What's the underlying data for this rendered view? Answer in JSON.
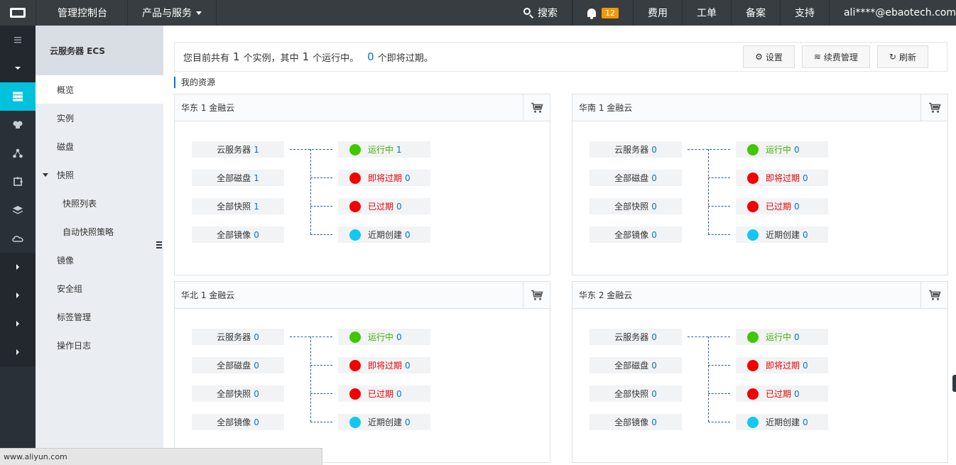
{
  "topbar": {
    "console": "管理控制台",
    "products": "产品与服务",
    "search": "搜索",
    "notify_count": "12",
    "billing": "费用",
    "ticket": "工单",
    "icp": "备案",
    "support": "支持",
    "user": "ali****@ebaotech.com"
  },
  "subnav": {
    "title": "云服务器 ECS",
    "items": [
      {
        "label": "概览"
      },
      {
        "label": "实例"
      },
      {
        "label": "磁盘"
      },
      {
        "label": "快照"
      },
      {
        "label": "快照列表"
      },
      {
        "label": "自动快照策略"
      },
      {
        "label": "镜像"
      },
      {
        "label": "安全组"
      },
      {
        "label": "标签管理"
      },
      {
        "label": "操作日志"
      }
    ]
  },
  "summary": {
    "prefix": "您目前共有",
    "total": "1",
    "mid": "个实例，其中",
    "running": "1",
    "mid2": "个运行中。",
    "expiring": "0",
    "suffix": "个即将过期。"
  },
  "buttons": {
    "settings": "设置",
    "renew": "续费管理",
    "refresh": "刷新"
  },
  "section_title": "我的资源",
  "panels": [
    {
      "region": "华东 1 金融云",
      "servers_label": "云服务器",
      "servers": "1",
      "disks_label": "全部磁盘",
      "disks": "1",
      "snapshots_label": "全部快照",
      "snapshots": "1",
      "images_label": "全部镜像",
      "images": "0",
      "running_label": "运行中",
      "running": "1",
      "expiring_label": "即将过期",
      "expiring": "0",
      "expired_label": "已过期",
      "expired": "0",
      "recent_label": "近期创建",
      "recent": "0"
    },
    {
      "region": "华南 1 金融云",
      "servers_label": "云服务器",
      "servers": "0",
      "disks_label": "全部磁盘",
      "disks": "0",
      "snapshots_label": "全部快照",
      "snapshots": "0",
      "images_label": "全部镜像",
      "images": "0",
      "running_label": "运行中",
      "running": "0",
      "expiring_label": "即将过期",
      "expiring": "0",
      "expired_label": "已过期",
      "expired": "0",
      "recent_label": "近期创建",
      "recent": "0"
    },
    {
      "region": "华北 1 金融云",
      "servers_label": "云服务器",
      "servers": "0",
      "disks_label": "全部磁盘",
      "disks": "0",
      "snapshots_label": "全部快照",
      "snapshots": "0",
      "images_label": "全部镜像",
      "images": "0",
      "running_label": "运行中",
      "running": "0",
      "expiring_label": "即将过期",
      "expiring": "0",
      "expired_label": "已过期",
      "expired": "0",
      "recent_label": "近期创建",
      "recent": "0"
    },
    {
      "region": "华东 2 金融云",
      "servers_label": "云服务器",
      "servers": "0",
      "disks_label": "全部磁盘",
      "disks": "0",
      "snapshots_label": "全部快照",
      "snapshots": "0",
      "images_label": "全部镜像",
      "images": "0",
      "running_label": "运行中",
      "running": "0",
      "expiring_label": "即将过期",
      "expiring": "0",
      "expired_label": "已过期",
      "expired": "0",
      "recent_label": "近期创建",
      "recent": "0"
    }
  ],
  "status_colors": {
    "running": "#3fc800",
    "expiring": "#f20000",
    "expired": "#f20000",
    "recent": "#12c8f0"
  },
  "statusbar": "www.aliyun.com"
}
